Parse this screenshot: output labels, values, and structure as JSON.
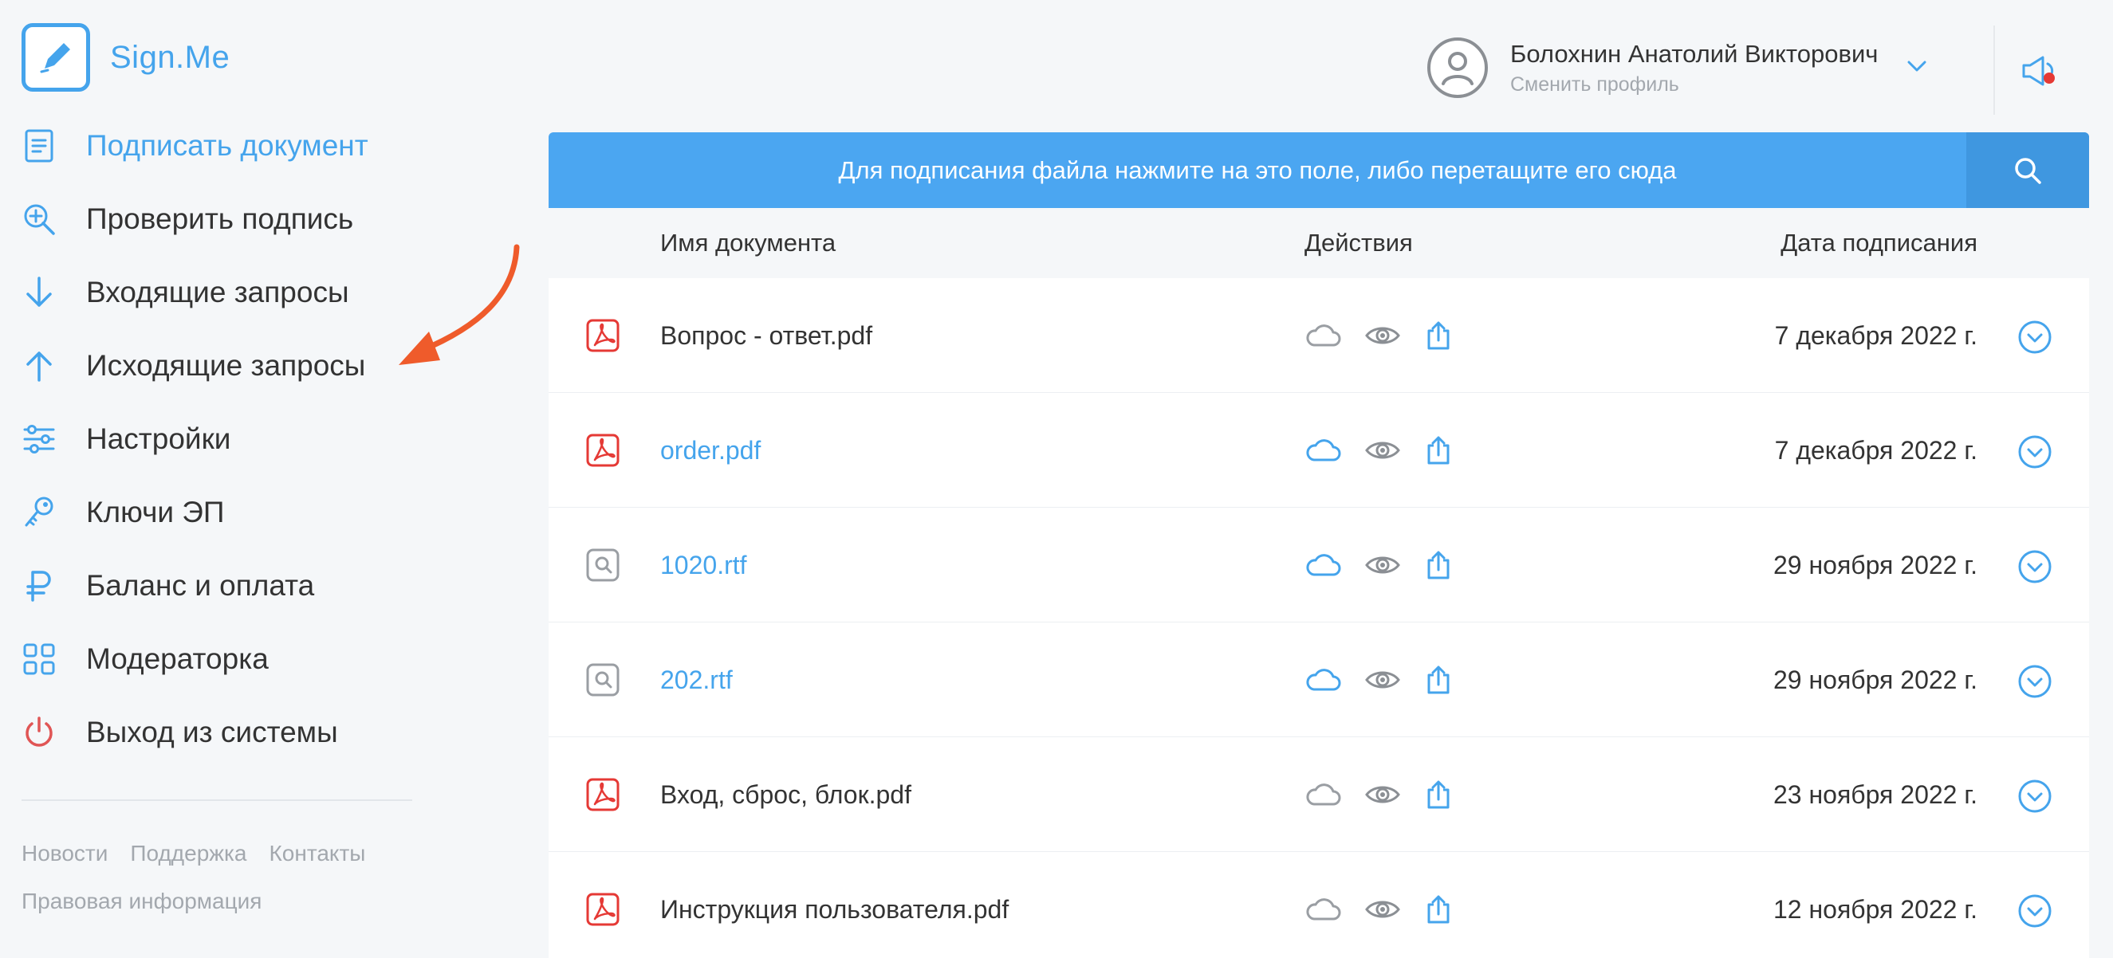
{
  "app": {
    "name": "Sign.Me",
    "accent_color": "#45a4ec"
  },
  "sidebar": {
    "items": [
      {
        "label": "Подписать документ",
        "icon": "document-icon",
        "active": true
      },
      {
        "label": "Проверить подпись",
        "icon": "magnifier-plus-icon",
        "active": false
      },
      {
        "label": "Входящие запросы",
        "icon": "arrow-down-icon",
        "active": false
      },
      {
        "label": "Исходящие запросы",
        "icon": "arrow-up-icon",
        "active": false
      },
      {
        "label": "Настройки",
        "icon": "sliders-icon",
        "active": false
      },
      {
        "label": "Ключи ЭП",
        "icon": "key-icon",
        "active": false
      },
      {
        "label": "Баланс и оплата",
        "icon": "ruble-icon",
        "active": false
      },
      {
        "label": "Модераторка",
        "icon": "grid-icon",
        "active": false
      },
      {
        "label": "Выход из системы",
        "icon": "power-icon",
        "active": false
      }
    ],
    "footer_links": [
      "Новости",
      "Поддержка",
      "Контакты",
      "Правовая информация"
    ]
  },
  "header": {
    "user_name": "Болохнин Анатолий Викторович",
    "switch_profile": "Сменить профиль",
    "notification_color": "#e53935"
  },
  "upload": {
    "text": "Для подписания файла нажмите на это поле, либо перетащите его сюда"
  },
  "table": {
    "columns": {
      "name": "Имя документа",
      "actions": "Действия",
      "date": "Дата подписания"
    },
    "rows": [
      {
        "name": "Вопрос - ответ.pdf",
        "type": "pdf",
        "link": false,
        "cloud_active": false,
        "date": "7 декабря 2022 г."
      },
      {
        "name": "order.pdf",
        "type": "pdf",
        "link": true,
        "cloud_active": true,
        "date": "7 декабря 2022 г."
      },
      {
        "name": "1020.rtf",
        "type": "rtf",
        "link": true,
        "cloud_active": true,
        "date": "29 ноября 2022 г."
      },
      {
        "name": "202.rtf",
        "type": "rtf",
        "link": true,
        "cloud_active": true,
        "date": "29 ноября 2022 г."
      },
      {
        "name": "Вход, сброс, блок.pdf",
        "type": "pdf",
        "link": false,
        "cloud_active": false,
        "date": "23 ноября 2022 г."
      },
      {
        "name": "Инструкция пользователя.pdf",
        "type": "pdf",
        "link": false,
        "cloud_active": false,
        "date": "12 ноября 2022 г."
      }
    ]
  }
}
